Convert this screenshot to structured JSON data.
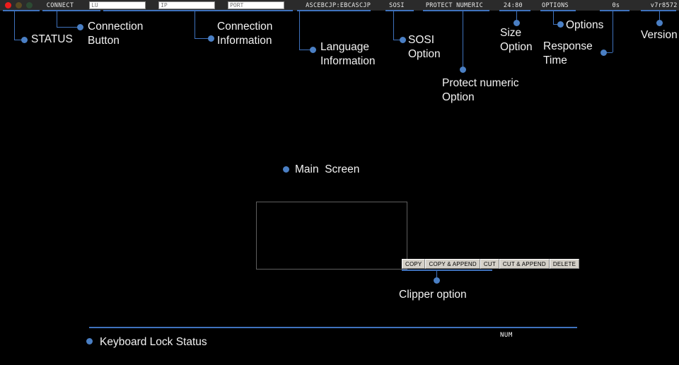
{
  "toolbar": {
    "status_leds": [
      {
        "name": "status-led-red",
        "color": "#ee1c1c"
      },
      {
        "name": "status-led-yellow",
        "color": "#5a4a22"
      },
      {
        "name": "status-led-green",
        "color": "#2c4a33"
      }
    ],
    "connect_button": "CONNECT",
    "lu_field": {
      "placeholder": "LU",
      "value": ""
    },
    "ip_field": {
      "placeholder": "IP",
      "value": ""
    },
    "port_field": {
      "placeholder": "PORT",
      "value": ""
    },
    "language_information": "ASCEBCJP:EBCASCJP",
    "sosi_option": "SOSI",
    "protect_numeric_option": "PROTECT NUMERIC",
    "size_option": "24:80",
    "options_button": "OPTIONS",
    "response_time": "0s",
    "version": "v7r8572"
  },
  "annotations": {
    "status": "STATUS",
    "connection_button": "Connection\nButton",
    "connection_information": "Connection\nInformation",
    "language_information": "Language\nInformation",
    "sosi_option": "SOSI\nOption",
    "protect_numeric_option": "Protect numeric\nOption",
    "size_option": "Size\nOption",
    "options": "Options",
    "response_time": "Response\nTime",
    "version": "Version",
    "main_screen": "Main  Screen",
    "clipper_option": "Clipper option",
    "keyboard_lock_status": "Keyboard Lock Status"
  },
  "clipper": {
    "buttons": [
      {
        "label": "COPY"
      },
      {
        "label": "COPY & APPEND"
      },
      {
        "label": "CUT"
      },
      {
        "label": "CUT & APPEND"
      },
      {
        "label": "DELETE"
      }
    ]
  },
  "status_bar": {
    "num_indicator": "NUM"
  },
  "colors": {
    "accent_blue": "#3f72bd",
    "dot_blue": "#4a7fc4",
    "toolbar_bg": "#2b2b2b",
    "page_bg": "#000000",
    "screen_border": "#5e5e5e",
    "menu_face": "#d4d0c8"
  }
}
